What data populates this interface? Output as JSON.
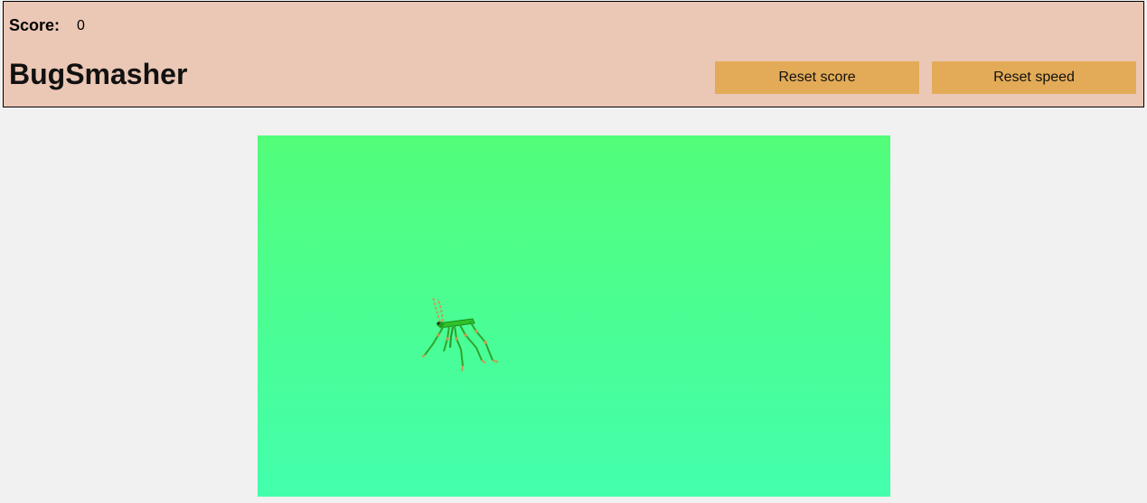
{
  "header": {
    "score_label": "Score:",
    "score_value": "0",
    "title": "BugSmasher"
  },
  "buttons": {
    "reset_score": "Reset score",
    "reset_speed": "Reset speed"
  },
  "game": {
    "bug": "bug-sprite"
  },
  "colors": {
    "header_bg": "#ebc7b5",
    "button_bg": "#e3ab57",
    "canvas_top": "#52fd79",
    "canvas_bottom": "#43ffad"
  }
}
